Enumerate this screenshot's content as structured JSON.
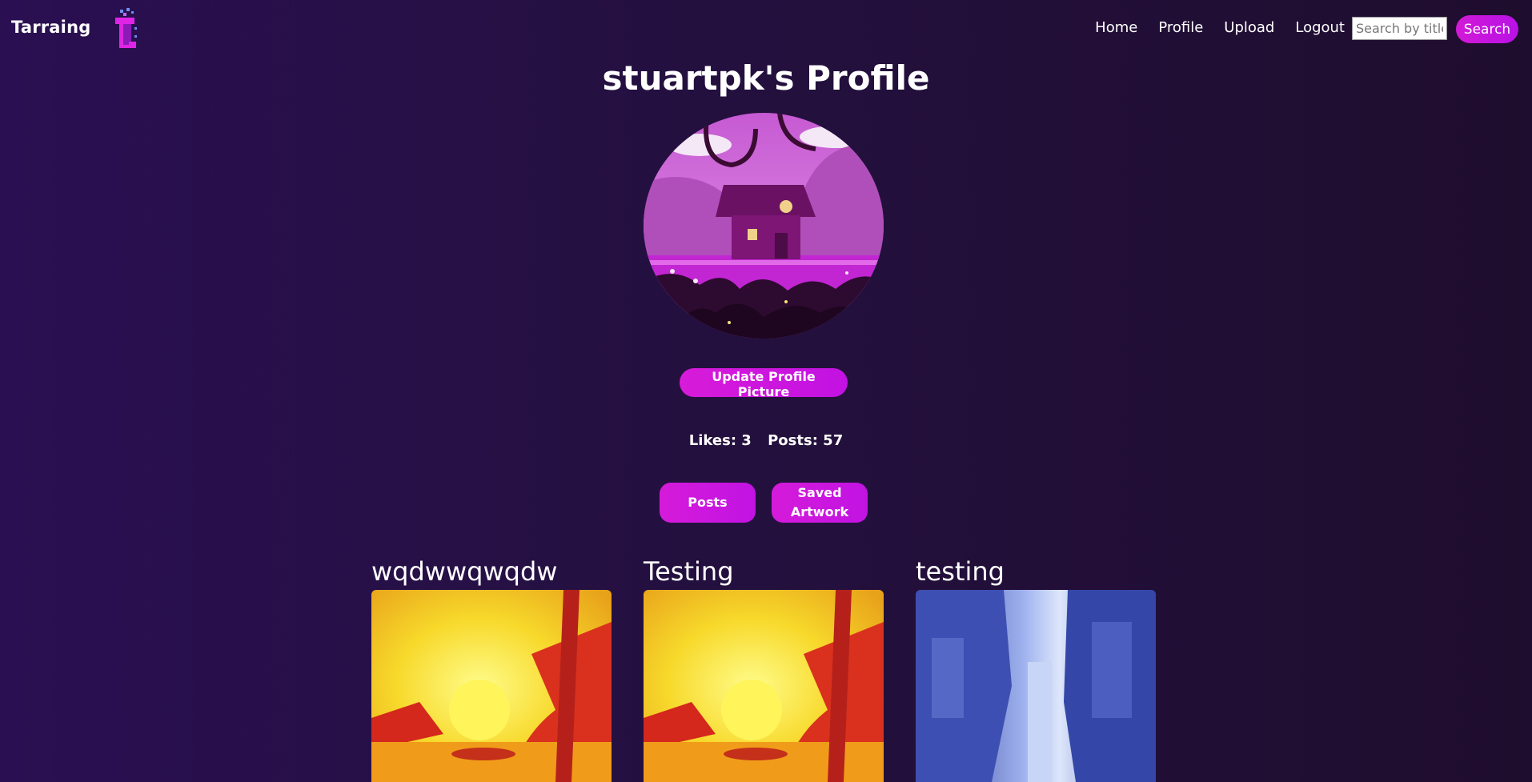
{
  "nav": {
    "brand": "Tarraing",
    "links": [
      "Home",
      "Profile",
      "Upload",
      "Logout"
    ],
    "search_placeholder": "Search by title",
    "search_button": "Search"
  },
  "profile": {
    "title": "stuartpk's Profile",
    "update_button": "Update Profile Picture",
    "likes": "Likes: 3",
    "posts": "Posts: 57",
    "tabs": [
      "Posts",
      "Saved Artwork"
    ]
  },
  "posts": [
    {
      "title": "wqdwwqwqdw"
    },
    {
      "title": "Testing"
    },
    {
      "title": "testing"
    }
  ],
  "colors": {
    "accent": "#d11ad6",
    "background": "#24103f"
  }
}
